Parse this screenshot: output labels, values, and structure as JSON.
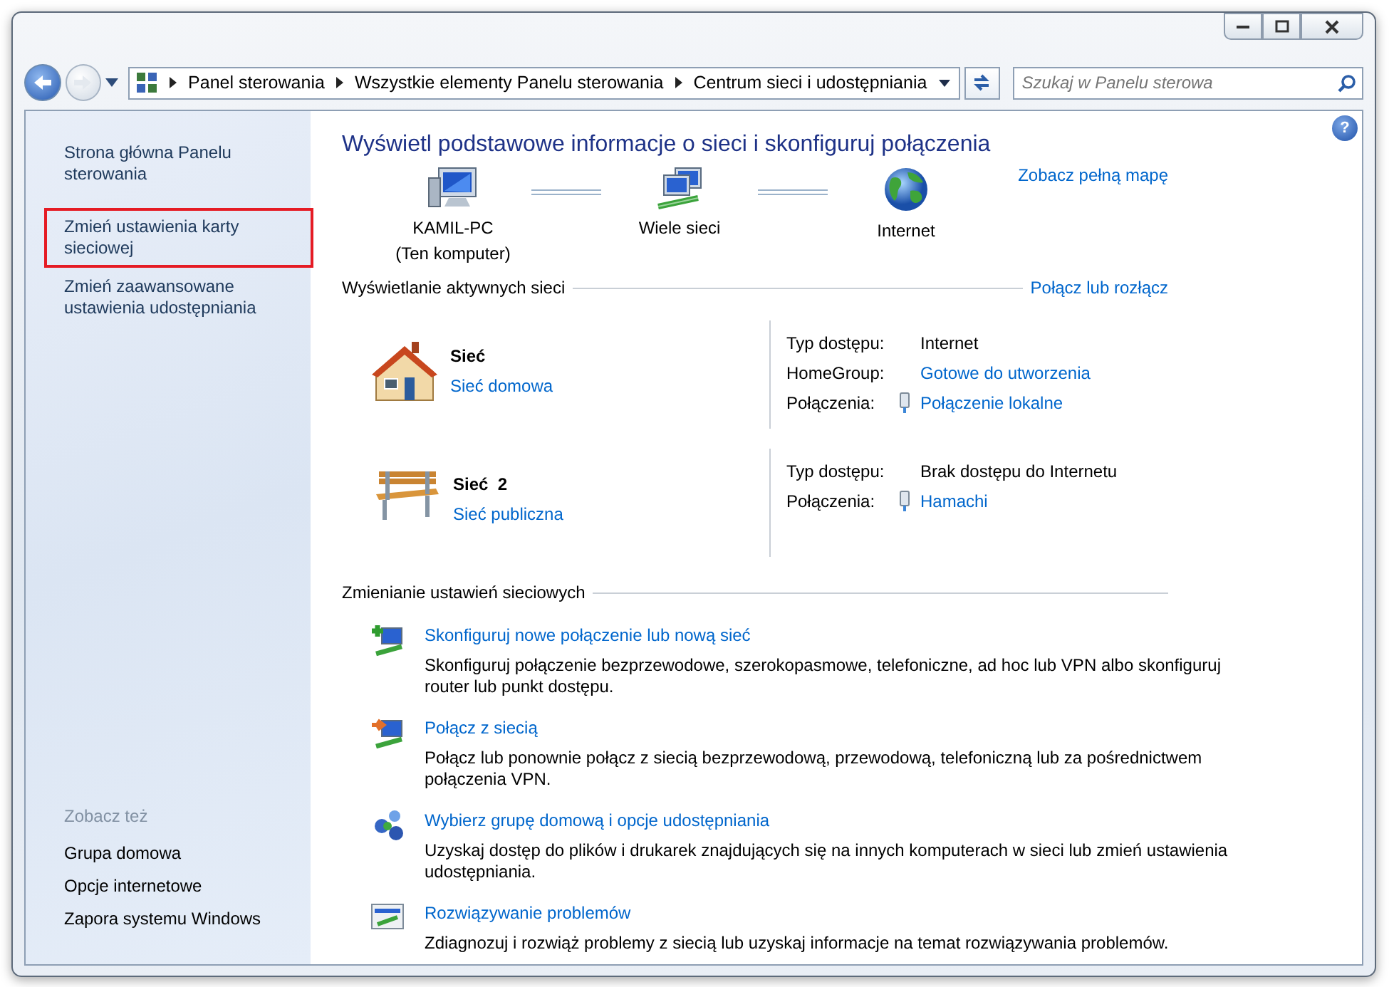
{
  "address_bar": {
    "breadcrumbs": [
      "Panel sterowania",
      "Wszystkie elementy Panelu sterowania",
      "Centrum sieci i udostępniania"
    ]
  },
  "search": {
    "placeholder": "Szukaj w Panelu sterowa"
  },
  "help": "?",
  "sidebar": {
    "items": [
      {
        "label": "Strona główna Panelu sterowania",
        "highlighted": false
      },
      {
        "label": "Zmień ustawienia karty sieciowej",
        "highlighted": true
      },
      {
        "label": "Zmień zaawansowane ustawienia udostępniania",
        "highlighted": false
      }
    ],
    "see_also": {
      "heading": "Zobacz też",
      "items": [
        "Grupa domowa",
        "Opcje internetowe",
        "Zapora systemu Windows"
      ]
    }
  },
  "main": {
    "title": "Wyświetl podstawowe informacje o sieci i skonfiguruj połączenia",
    "map": {
      "nodes": [
        {
          "kind": "computer",
          "label": "KAMIL-PC",
          "sublabel": "(Ten komputer)"
        },
        {
          "kind": "networks",
          "label": "Wiele sieci"
        },
        {
          "kind": "internet",
          "label": "Internet"
        }
      ],
      "full_map_link": "Zobacz pełną mapę"
    },
    "active_networks": {
      "heading": "Wyświetlanie aktywnych sieci",
      "action_link": "Połącz lub rozłącz",
      "networks": [
        {
          "kind": "home",
          "name": "Sieć",
          "type_link": "Sieć domowa",
          "details": [
            {
              "label": "Typ dostępu:",
              "value": "Internet",
              "kind": "text"
            },
            {
              "label": "HomeGroup:",
              "value": "Gotowe do utworzenia",
              "kind": "link"
            },
            {
              "label": "Połączenia:",
              "value": "Połączenie lokalne",
              "kind": "connection"
            }
          ]
        },
        {
          "kind": "public",
          "name": "Sieć  2",
          "type_link": "Sieć publiczna",
          "details": [
            {
              "label": "Typ dostępu:",
              "value": "Brak dostępu do Internetu",
              "kind": "text"
            },
            {
              "label": "Połączenia:",
              "value": "Hamachi",
              "kind": "connection"
            }
          ]
        }
      ]
    },
    "change_settings": {
      "heading": "Zmienianie ustawień sieciowych",
      "tasks": [
        {
          "kind": "new_connection",
          "title": "Skonfiguruj nowe połączenie lub nową sieć",
          "description": "Skonfiguruj połączenie bezprzewodowe, szerokopasmowe, telefoniczne, ad hoc lub VPN albo skonfiguruj router lub punkt dostępu."
        },
        {
          "kind": "connect",
          "title": "Połącz z siecią",
          "description": "Połącz lub ponownie połącz z siecią bezprzewodową, przewodową, telefoniczną lub za pośrednictwem połączenia VPN."
        },
        {
          "kind": "homegroup",
          "title": "Wybierz grupę domową i opcje udostępniania",
          "description": "Uzyskaj dostęp do plików i drukarek znajdujących się na innych komputerach w sieci lub zmień ustawienia udostępniania."
        },
        {
          "kind": "troubleshoot",
          "title": "Rozwiązywanie problemów",
          "description": "Zdiagnozuj i rozwiąż problemy z siecią lub uzyskaj informacje na temat rozwiązywania problemów."
        }
      ]
    }
  }
}
